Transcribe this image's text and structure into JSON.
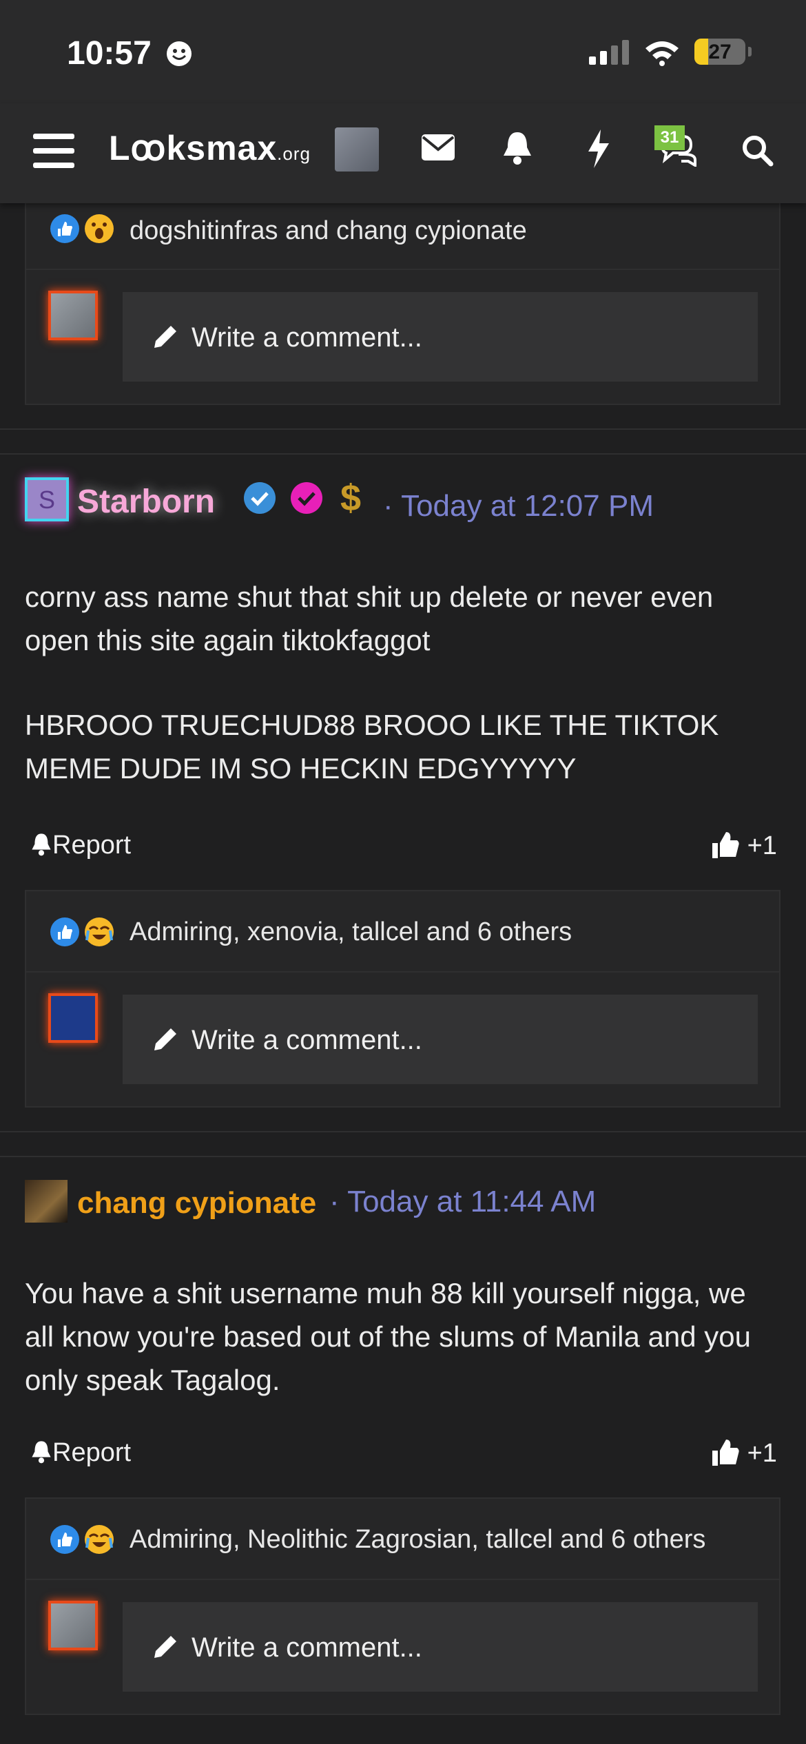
{
  "status_bar": {
    "time": "10:57",
    "battery": "27",
    "battery_level": 0.27
  },
  "header": {
    "logo": "Lꝏksmax",
    "logo_suffix": ".org",
    "conversations_badge": "31",
    "icons": [
      "menu-icon",
      "avatar",
      "mail-icon",
      "bell-icon",
      "lightning-icon",
      "conversations-icon",
      "search-icon"
    ]
  },
  "top_panel": {
    "reactions_text": "dogshitinfras and chang cypionate",
    "comment_placeholder": "Write a comment..."
  },
  "posts": [
    {
      "avatar_letter": "S",
      "username": "Starborn",
      "username_color": "#f7a8d8",
      "time": "· Today at 12:07 PM",
      "body": [
        "corny ass name shut that shit up delete or never even open this site again tiktokfaggot",
        "HBROOO TRUECHUD88 BROOO LIKE THE TIKTOK MEME DUDE IM SO HECKIN EDGYYYYY"
      ],
      "report_label": "Report",
      "like_count": "+1",
      "reactions_text": "Admiring, xenovia, tallcel and 6 others",
      "comment_placeholder": "Write a comment..."
    },
    {
      "username": "chang cypionate",
      "username_color": "#f0a018",
      "time": "· Today at 11:44 AM",
      "body": [
        "You have a shit username muh 88 kill yourself nigga, we all know you're based out of the slums of Manila and you only speak Tagalog."
      ],
      "report_label": "Report",
      "like_count": "+1",
      "reactions_text": "Admiring, Neolithic Zagrosian, tallcel and 6 others",
      "comment_placeholder": "Write a comment..."
    }
  ],
  "colors": {
    "accent_link": "#7b82cf",
    "badge": "#7cc242",
    "avatar_glow": "#e84a1a"
  }
}
